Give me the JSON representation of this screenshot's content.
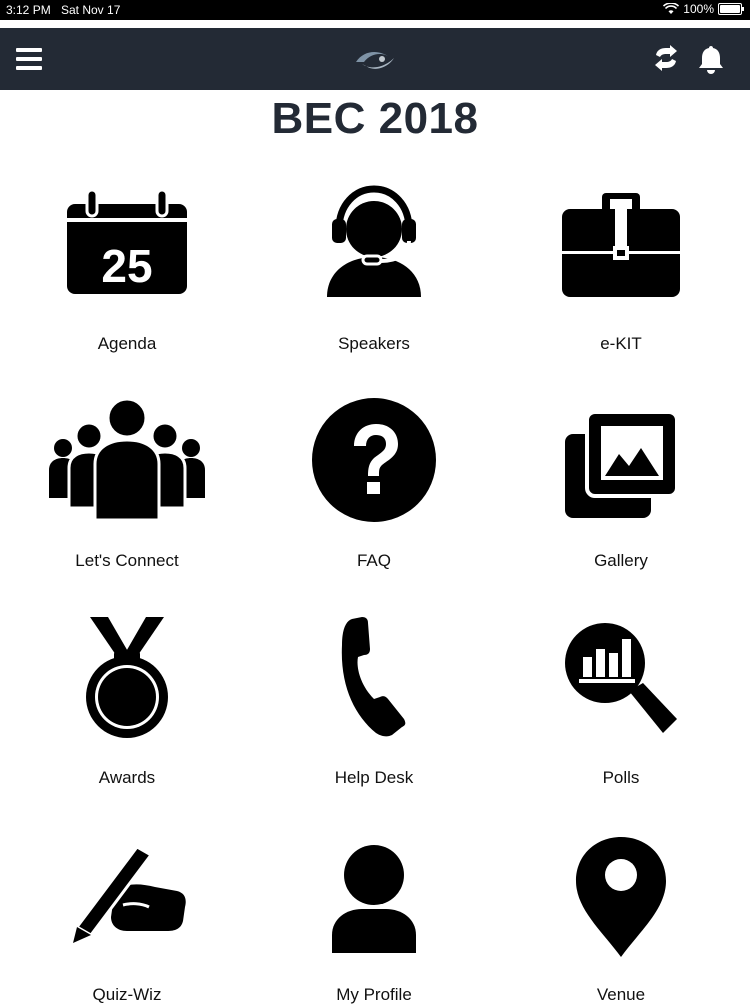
{
  "status_bar": {
    "time": "3:12 PM",
    "date": "Sat Nov 17",
    "battery": "100%"
  },
  "header": {
    "title": "BEC 2018"
  },
  "tiles": [
    {
      "label": "Agenda",
      "icon": "calendar-icon",
      "calendar_day": "25"
    },
    {
      "label": "Speakers",
      "icon": "headset-icon"
    },
    {
      "label": "e-KIT",
      "icon": "briefcase-icon"
    },
    {
      "label": "Let's Connect",
      "icon": "group-icon"
    },
    {
      "label": "FAQ",
      "icon": "question-icon"
    },
    {
      "label": "Gallery",
      "icon": "gallery-icon"
    },
    {
      "label": "Awards",
      "icon": "medal-icon"
    },
    {
      "label": "Help Desk",
      "icon": "phone-icon"
    },
    {
      "label": "Polls",
      "icon": "poll-search-icon"
    },
    {
      "label": "Quiz-Wiz",
      "icon": "writing-hand-icon"
    },
    {
      "label": "My Profile",
      "icon": "user-icon"
    },
    {
      "label": "Venue",
      "icon": "map-pin-icon"
    }
  ],
  "colors": {
    "navbar": "#232a35",
    "title": "#232a35",
    "icon": "#000000"
  }
}
